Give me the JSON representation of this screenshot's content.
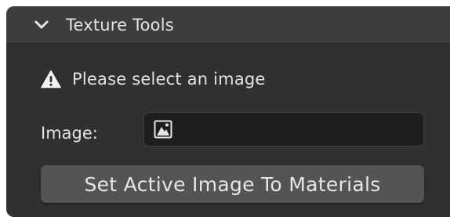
{
  "panel": {
    "title": "Texture Tools",
    "expanded_icon": "chevron-down-icon"
  },
  "warning": {
    "icon": "warning-icon",
    "text": "Please select an image"
  },
  "image_field": {
    "label": "Image:",
    "icon": "image-icon",
    "value": ""
  },
  "action": {
    "label": "Set Active Image To Materials"
  },
  "colors": {
    "panel_bg": "#303030",
    "header_bg": "#3d3d3d",
    "field_bg": "#1e1e1e",
    "button_bg": "#545454",
    "text": "#e3e3e3"
  }
}
